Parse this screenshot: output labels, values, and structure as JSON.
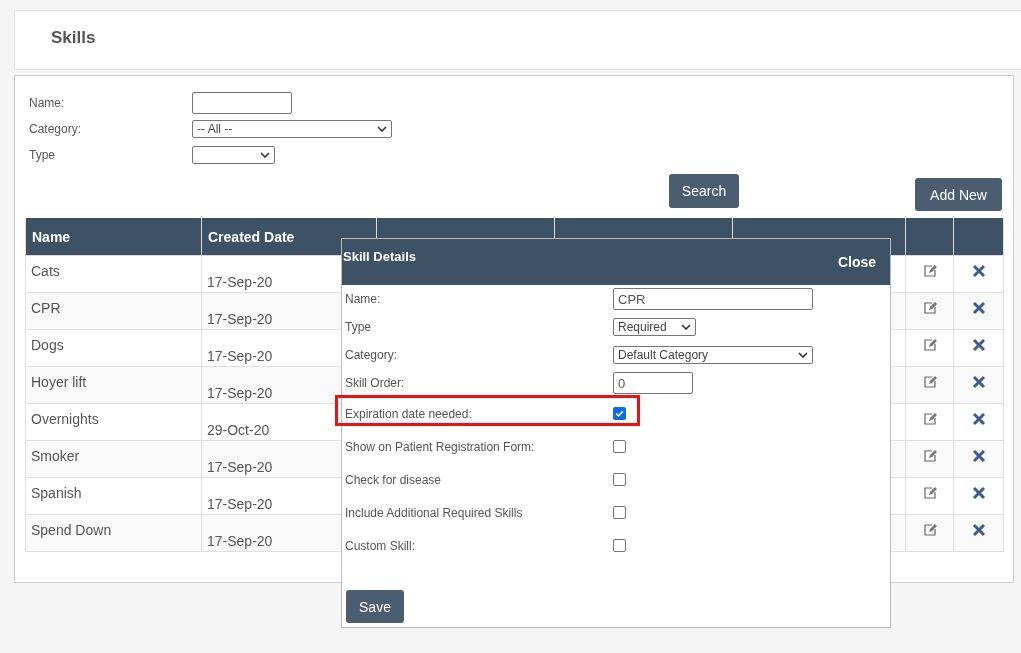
{
  "header": {
    "title": "Skills"
  },
  "filters": [
    {
      "label": "Name:",
      "kind": "text"
    },
    {
      "label": "Category:",
      "kind": "select",
      "value": "-- All --"
    },
    {
      "label": "Type",
      "kind": "select"
    }
  ],
  "buttons": {
    "search": "Search",
    "add_new": "Add New"
  },
  "table": {
    "columns": [
      "Name",
      "Created Date"
    ],
    "rows": [
      {
        "name": "Cats",
        "created_date": "17-Sep-20"
      },
      {
        "name": "CPR",
        "created_date": "17-Sep-20"
      },
      {
        "name": "Dogs",
        "created_date": "17-Sep-20"
      },
      {
        "name": "Hoyer lift",
        "created_date": "17-Sep-20"
      },
      {
        "name": "Overnights",
        "created_date": "29-Oct-20"
      },
      {
        "name": "Smoker",
        "created_date": "17-Sep-20"
      },
      {
        "name": "Spanish",
        "created_date": "17-Sep-20"
      },
      {
        "name": "Spend Down",
        "created_date": "17-Sep-20"
      }
    ]
  },
  "dialog": {
    "title": "Skill Details",
    "close": "Close",
    "fields": [
      {
        "label": "Name:",
        "kind": "text",
        "value": "CPR"
      },
      {
        "label": "Type",
        "kind": "select",
        "value": "Required"
      },
      {
        "label": "Category:",
        "kind": "select",
        "value": "Default Category"
      },
      {
        "label": "Skill Order:",
        "kind": "text",
        "value": "0"
      },
      {
        "label": "Expiration date needed:",
        "kind": "checkbox",
        "checked": true,
        "highlighted": true
      },
      {
        "label": "Show on Patient Registration Form:",
        "kind": "checkbox",
        "checked": false,
        "highlighted": false
      },
      {
        "label": "Check for disease",
        "kind": "checkbox",
        "checked": false,
        "highlighted": false
      },
      {
        "label": "Include Additional Required Skills",
        "kind": "checkbox",
        "checked": false,
        "highlighted": false
      },
      {
        "label": "Custom Skill:",
        "kind": "checkbox",
        "checked": false,
        "highlighted": false
      }
    ],
    "save": "Save"
  }
}
